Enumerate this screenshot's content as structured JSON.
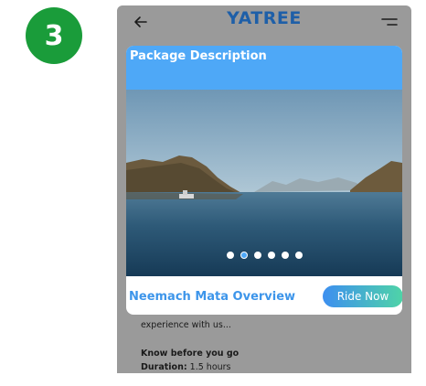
{
  "step": {
    "number": "3"
  },
  "app": {
    "brand": "YATREE"
  },
  "modal": {
    "title": "Package Description",
    "slider": {
      "dot_count": 6,
      "active_index": 1
    },
    "overview_title": "Neemach Mata Overview",
    "ride_button_label": "Ride Now"
  },
  "background": {
    "line1": "experience with us...",
    "know_before": "Know before you go",
    "duration_label": "Duration:",
    "duration_value": "1.5 hours"
  },
  "colors": {
    "step_badge": "#1a9c3a",
    "brand": "#1e5fa8",
    "modal_header": "#4ea8f7",
    "overview_title": "#3d95ea",
    "button_gradient_start": "#3d8ff0",
    "button_gradient_end": "#4fd4a7"
  },
  "icons": {
    "back": "arrow-left-icon",
    "menu": "hamburger-menu-icon"
  }
}
